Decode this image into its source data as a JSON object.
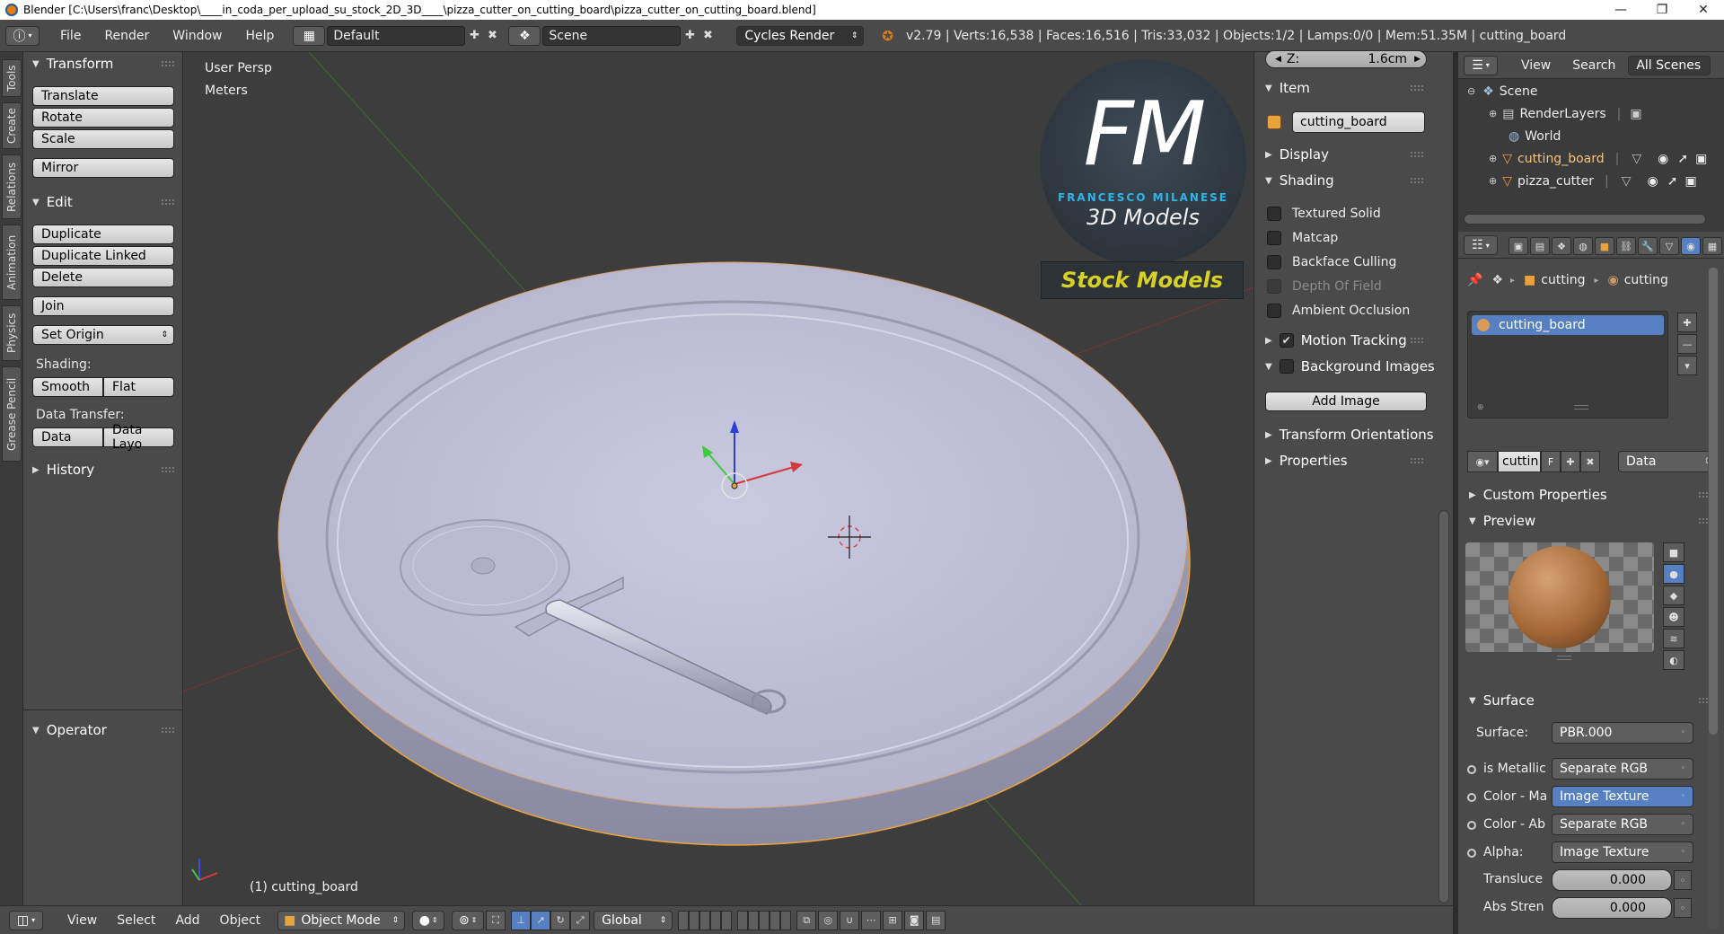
{
  "window": {
    "title": "Blender [C:\\Users\\franc\\Desktop\\____in_coda_per_upload_su_stock_2D_3D____\\pizza_cutter_on_cutting_board\\pizza_cutter_on_cutting_board.blend]",
    "minimize": "—",
    "maximize": "❐",
    "close": "✕"
  },
  "info_header": {
    "menu": [
      "File",
      "Render",
      "Window",
      "Help"
    ],
    "screen_layout": "Default",
    "scene": "Scene",
    "render_engine": "Cycles Render",
    "stats": "v2.79 | Verts:16,538 | Faces:16,516 | Tris:33,032 | Objects:1/2 | Lamps:0/0 | Mem:51.35M | cutting_board"
  },
  "tool_tabs": [
    "Tools",
    "Create",
    "Relations",
    "Animation",
    "Physics",
    "Grease Pencil"
  ],
  "tool_shelf": {
    "transform": {
      "title": "Transform",
      "buttons": [
        "Translate",
        "Rotate",
        "Scale",
        "Mirror"
      ]
    },
    "edit": {
      "title": "Edit",
      "buttons": [
        "Duplicate",
        "Duplicate Linked",
        "Delete",
        "Join"
      ],
      "set_origin": "Set Origin"
    },
    "shading_label": "Shading:",
    "smooth": "Smooth",
    "flat": "Flat",
    "data_transfer_label": "Data Transfer:",
    "data": "Data",
    "data_layout": "Data Layo",
    "history": "History",
    "operator": "Operator"
  },
  "viewport": {
    "view_name": "User Persp",
    "units": "Meters",
    "selected_object": "(1) cutting_board",
    "watermark": {
      "initials": "FM",
      "name": "FRANCESCO MILANESE",
      "tagline": "3D Models",
      "badge": "Stock Models"
    }
  },
  "n_panel": {
    "z_label": "Z:",
    "z_value": "1.6cm",
    "item": {
      "title": "Item",
      "object_name": "cutting_board"
    },
    "display": "Display",
    "shading": {
      "title": "Shading",
      "options": [
        {
          "label": "Textured Solid",
          "checked": false,
          "enabled": true
        },
        {
          "label": "Matcap",
          "checked": false,
          "enabled": true
        },
        {
          "label": "Backface Culling",
          "checked": false,
          "enabled": true
        },
        {
          "label": "Depth Of Field",
          "checked": false,
          "enabled": false
        },
        {
          "label": "Ambient Occlusion",
          "checked": false,
          "enabled": true
        }
      ]
    },
    "motion_tracking": "Motion Tracking",
    "background_images": "Background Images",
    "add_image": "Add Image",
    "transform_orientations": "Transform Orientations",
    "properties": "Properties"
  },
  "outliner": {
    "view": "View",
    "search": "Search",
    "filter": "All Scenes",
    "tree": [
      "Scene",
      "RenderLayers",
      "World",
      "cutting_board",
      "pizza_cutter"
    ]
  },
  "properties_editor": {
    "breadcrumb": [
      "cutting",
      "cutting"
    ],
    "material_slot": "cutting_board",
    "material_field": "cuttin",
    "fake_user": "F",
    "link": "Data",
    "custom_properties": "Custom Properties",
    "preview": "Preview",
    "surface_title": "Surface",
    "surface_label": "Surface:",
    "surface_value": "PBR.000",
    "inputs": [
      {
        "label": "is Metallic",
        "value": "Separate RGB",
        "highlight": false
      },
      {
        "label": "Color - Ma",
        "value": "Image Texture",
        "highlight": true
      },
      {
        "label": "Color - Ab",
        "value": "Separate RGB",
        "highlight": false
      },
      {
        "label": "Alpha:",
        "value": "Image Texture",
        "highlight": false
      }
    ],
    "translucency": {
      "label": "Transluce",
      "value": "0.000"
    },
    "abs_strength": {
      "label": "Abs Stren",
      "value": "0.000"
    }
  },
  "view3d_header": {
    "menu": [
      "View",
      "Select",
      "Add",
      "Object"
    ],
    "mode": "Object Mode",
    "orientation": "Global"
  },
  "colors": {
    "accent": "#5680c2",
    "selection": "#e8a33d",
    "fm_blue": "#2fb4e8",
    "stock_yellow": "#d7d126"
  }
}
